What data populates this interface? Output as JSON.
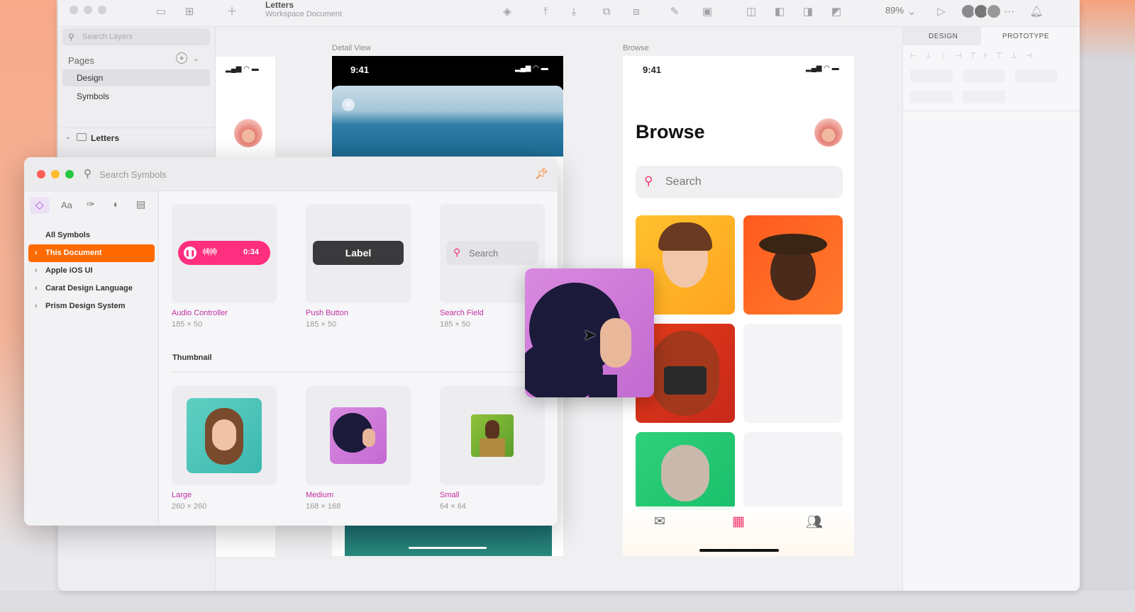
{
  "toolbar": {
    "doc_title": "Letters",
    "doc_subtitle": "Workspace Document",
    "zoom": "89%"
  },
  "layers": {
    "search_placeholder": "Search Layers",
    "pages_label": "Pages",
    "pages": [
      "Design",
      "Symbols"
    ],
    "group_label": "Letters"
  },
  "canvas": {
    "artboards": [
      "Detail View",
      "Browse"
    ],
    "status_time": "9:41"
  },
  "browse": {
    "title": "Browse",
    "search_placeholder": "Search"
  },
  "inspector": {
    "tabs": [
      "DESIGN",
      "PROTOTYPE"
    ]
  },
  "symbols": {
    "search_placeholder": "Search Symbols",
    "categories": [
      "All Symbols",
      "This Document",
      "Apple iOS UI",
      "Carat Design Language",
      "Prism Design System"
    ],
    "row1": [
      {
        "name": "Audio Controller",
        "size": "185 × 50",
        "time": "0:34"
      },
      {
        "name": "Push Button",
        "size": "185 × 50",
        "label": "Label"
      },
      {
        "name": "Search Field",
        "size": "185 × 50",
        "placeholder": "Search"
      }
    ],
    "section": "Thumbnail",
    "row2": [
      {
        "name": "Large",
        "size": "260 × 260"
      },
      {
        "name": "Medium",
        "size": "168 × 168"
      },
      {
        "name": "Small",
        "size": "64 × 64"
      }
    ],
    "tab_icons": [
      "symbol-icon",
      "text-style-icon",
      "layer-style-icon",
      "color-icon",
      "swatch-icon"
    ]
  },
  "colors": {
    "accent": "#ff6a00",
    "magenta": "#c02fa0",
    "audio": "#ff2e7e",
    "button": "#3a3a3c"
  }
}
